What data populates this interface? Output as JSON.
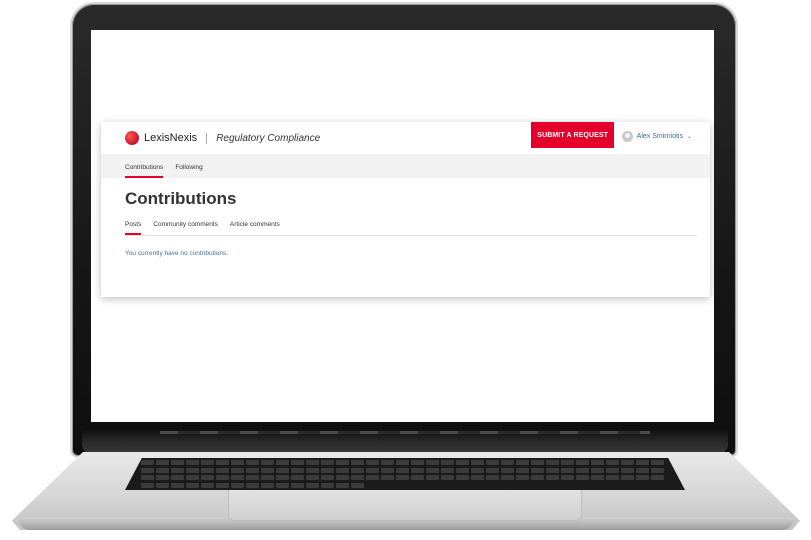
{
  "brand": {
    "name": "LexisNexis",
    "product": "Regulatory Compliance",
    "accent_color": "#e4002b"
  },
  "header": {
    "submit_label": "SUBMIT A REQUEST",
    "user_name": "Alex Smirniotis",
    "user_caret": "⌄"
  },
  "subnav": {
    "items": [
      {
        "label": "Contributions",
        "active": true
      },
      {
        "label": "Following",
        "active": false
      }
    ]
  },
  "main": {
    "title": "Contributions",
    "tabs": [
      {
        "label": "Posts",
        "active": true
      },
      {
        "label": "Community comments",
        "active": false
      },
      {
        "label": "Article comments",
        "active": false
      }
    ],
    "empty_message": "You currently have no contributions."
  }
}
